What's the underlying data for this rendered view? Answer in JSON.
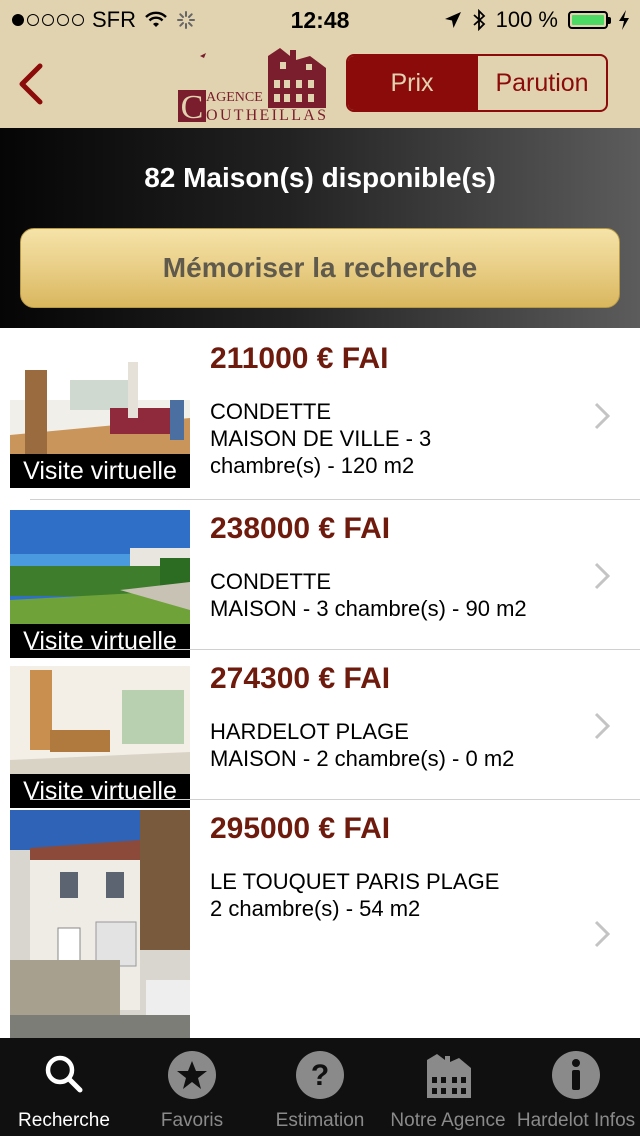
{
  "status_bar": {
    "carrier": "SFR",
    "time": "12:48",
    "battery": "100 %"
  },
  "header": {
    "back_icon": "chevron-left-icon",
    "logo": {
      "line1": "AGENCE",
      "line2": "COUTHEILLAS"
    },
    "sort": {
      "options": [
        "Prix",
        "Parution"
      ],
      "selected": "Prix"
    }
  },
  "banner": {
    "count_text": "82 Maison(s) disponible(s)",
    "save_button": "Mémoriser la recherche"
  },
  "listings": [
    {
      "price": "211000 € FAI",
      "lines": [
        "CONDETTE",
        "MAISON DE VILLE - 3",
        "chambre(s) - 120 m2"
      ],
      "badge": "Visite virtuelle"
    },
    {
      "price": "238000 € FAI",
      "lines": [
        "CONDETTE",
        "MAISON - 3 chambre(s) - 90 m2"
      ],
      "badge": "Visite virtuelle"
    },
    {
      "price": "274300 € FAI",
      "lines": [
        "HARDELOT PLAGE",
        "MAISON - 2 chambre(s) - 0 m2"
      ],
      "badge": "Visite virtuelle"
    },
    {
      "price": "295000 € FAI",
      "lines": [
        "LE TOUQUET PARIS PLAGE",
        "2 chambre(s) - 54 m2"
      ],
      "badge": ""
    }
  ],
  "tabbar": {
    "items": [
      {
        "label": "Recherche",
        "icon": "search-icon",
        "active": true
      },
      {
        "label": "Favoris",
        "icon": "star-icon",
        "active": false
      },
      {
        "label": "Estimation",
        "icon": "question-icon",
        "active": false
      },
      {
        "label": "Notre Agence",
        "icon": "house-icon",
        "active": false
      },
      {
        "label": "Hardelot Infos",
        "icon": "info-icon",
        "active": false
      }
    ]
  },
  "colors": {
    "header_bg": "#e2d3b0",
    "accent": "#8b0a0a",
    "price": "#6e1a0d",
    "tabbar_bg": "#101010"
  }
}
